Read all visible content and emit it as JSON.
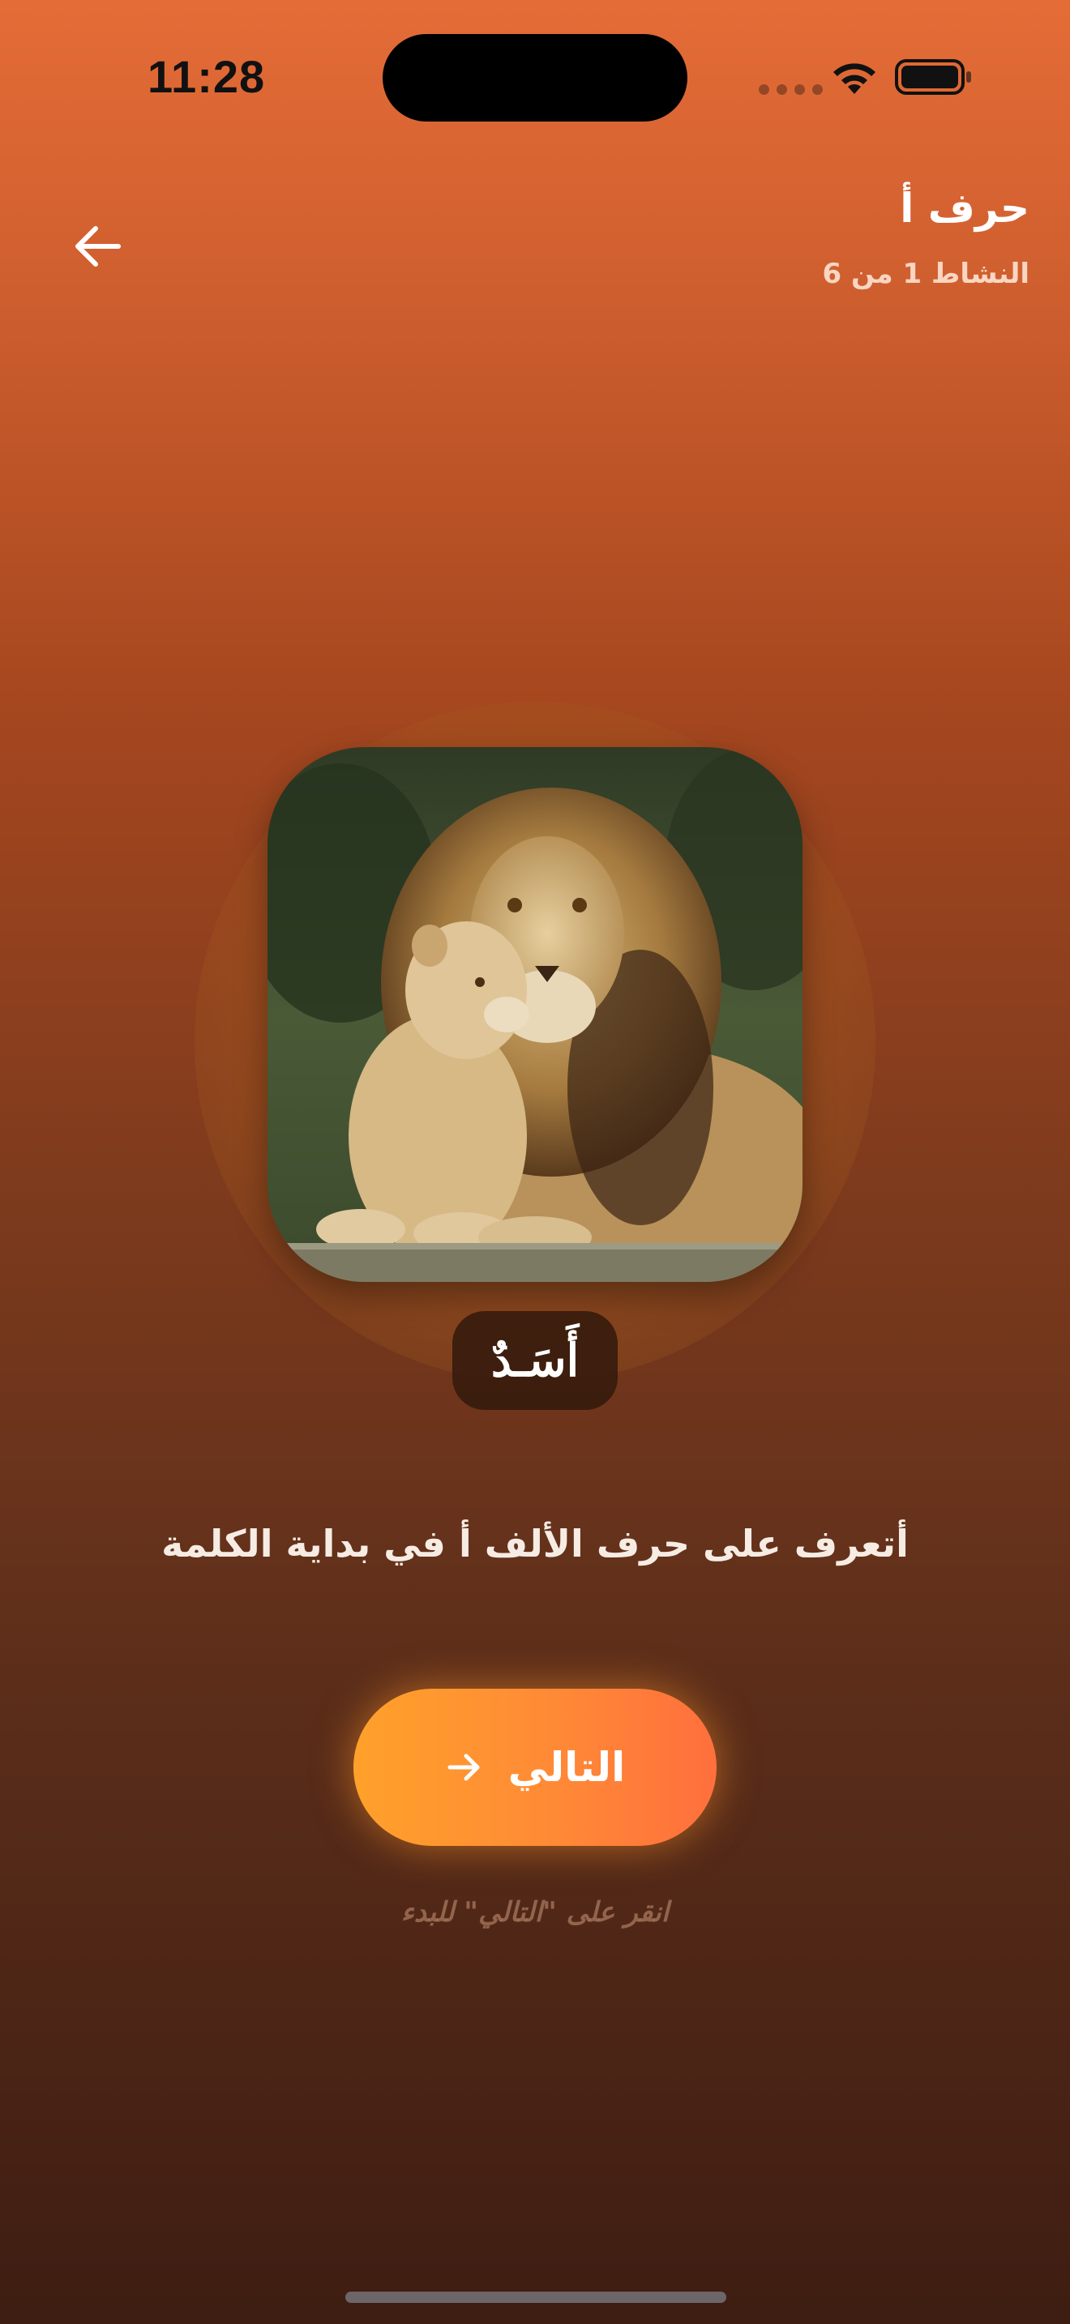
{
  "status_bar": {
    "time": "11:28"
  },
  "header": {
    "title": "حرف أ",
    "subtitle": "النشاط 1 من 6",
    "back_icon": "arrow-left-icon"
  },
  "card": {
    "image_subject": "lion-with-cub",
    "word": "أَسَـدٌ"
  },
  "instruction": "أتعرف على حرف الألف أ في بداية الكلمة",
  "next_button": {
    "label": "التالي",
    "icon": "arrow-right-icon"
  },
  "hint": "انقر على \"التالي\" للبدء",
  "colors": {
    "background_top": "#e46c37",
    "background_bottom": "#3e1d12",
    "button_start": "#ffa12a",
    "button_end": "#ff6f3d"
  }
}
